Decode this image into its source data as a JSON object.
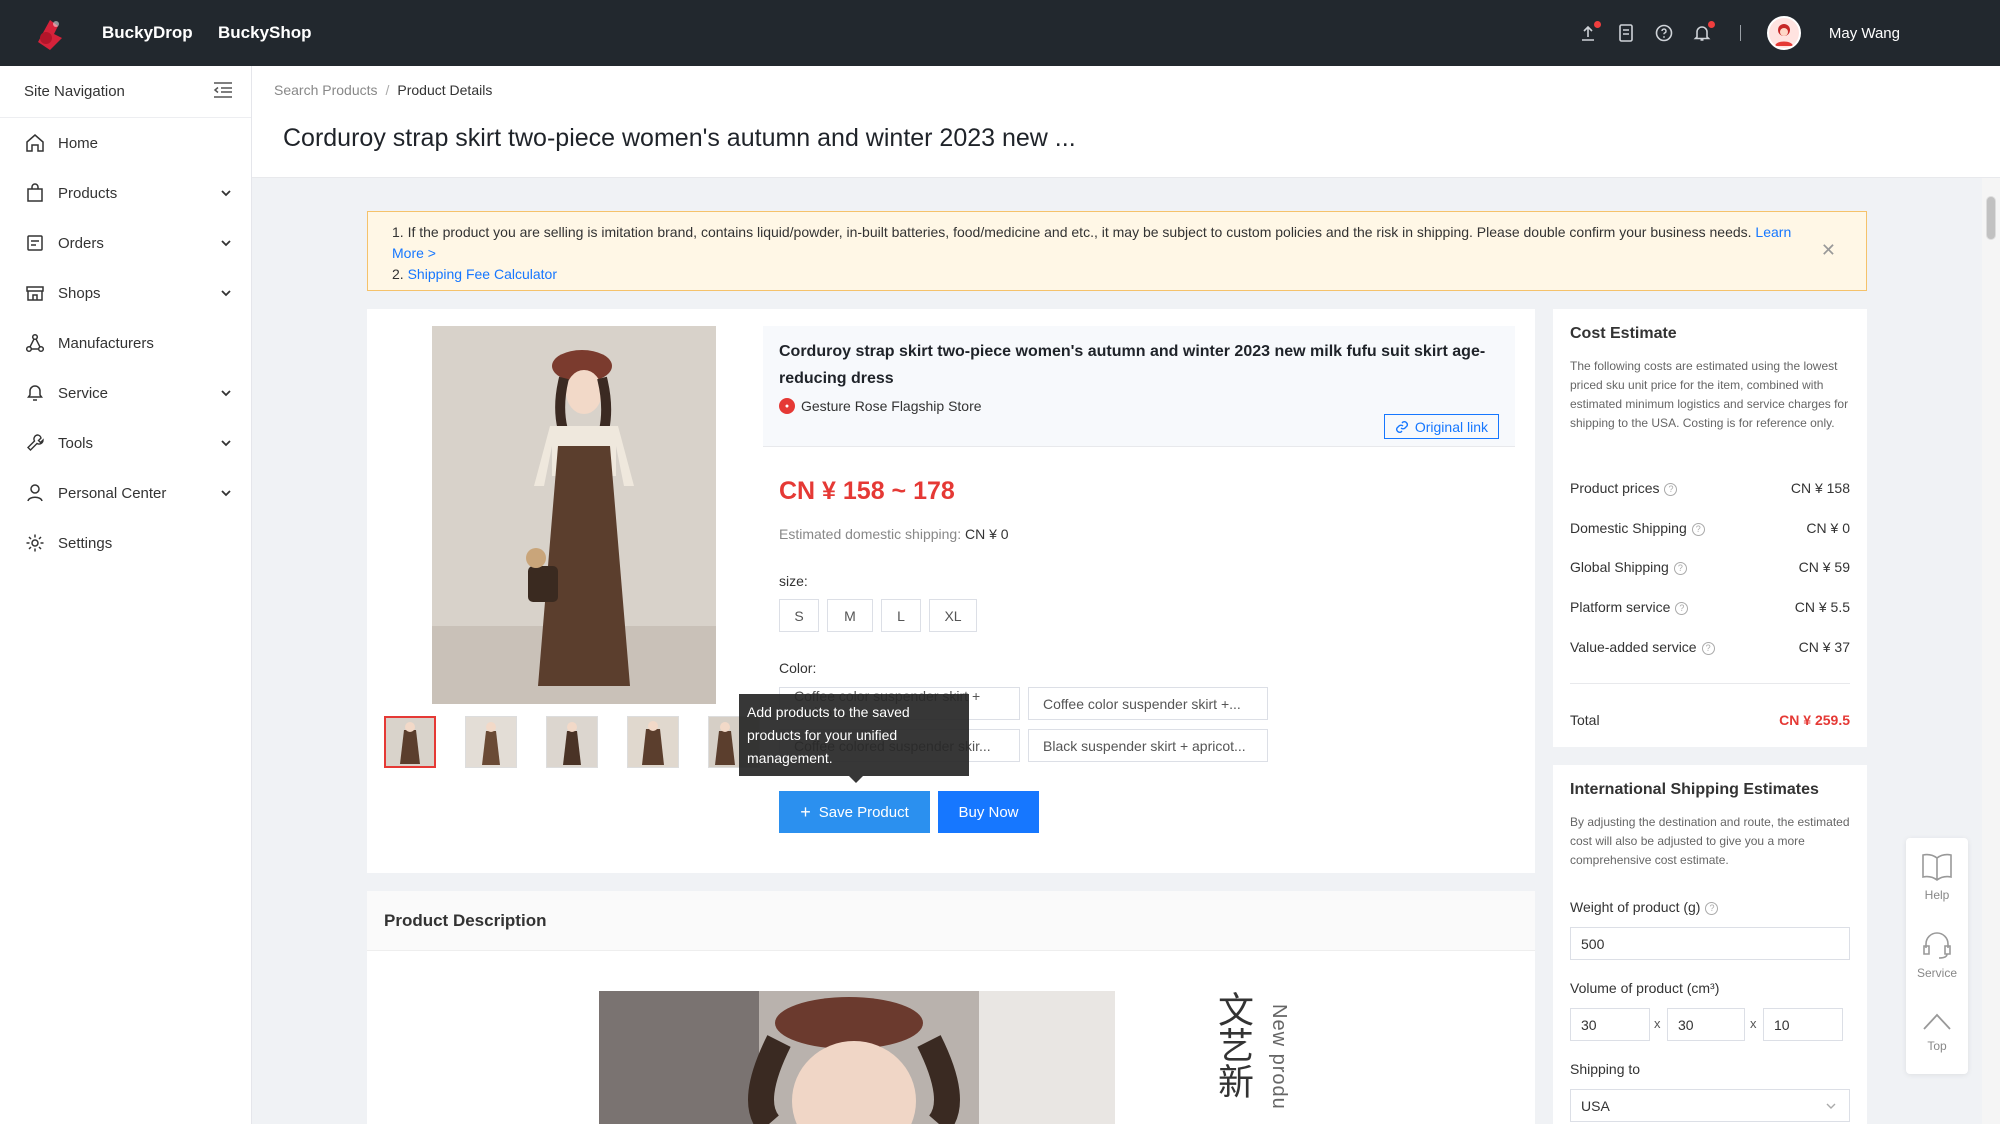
{
  "topbar": {
    "brand1": "BuckyDrop",
    "brand2": "BuckyShop",
    "icons": [
      "upload-icon",
      "document-icon",
      "help-icon",
      "bell-icon"
    ],
    "user_name": "May Wang"
  },
  "sidebar": {
    "title": "Site Navigation",
    "items": [
      {
        "label": "Home",
        "icon": "home-icon",
        "expandable": false
      },
      {
        "label": "Products",
        "icon": "bag-icon",
        "expandable": true
      },
      {
        "label": "Orders",
        "icon": "orders-icon",
        "expandable": true
      },
      {
        "label": "Shops",
        "icon": "shop-icon",
        "expandable": true
      },
      {
        "label": "Manufacturers",
        "icon": "network-icon",
        "expandable": false
      },
      {
        "label": "Service",
        "icon": "service-icon",
        "expandable": true
      },
      {
        "label": "Tools",
        "icon": "wrench-icon",
        "expandable": true
      },
      {
        "label": "Personal Center",
        "icon": "user-icon",
        "expandable": true
      },
      {
        "label": "Settings",
        "icon": "gear-icon",
        "expandable": false
      }
    ]
  },
  "header": {
    "breadcrumb": [
      "Search Products",
      "Product Details"
    ],
    "title": "Corduroy strap skirt two-piece women's autumn and winter 2023 new ..."
  },
  "alert": {
    "line1": "1. If the product you are selling is imitation brand, contains liquid/powder, in-built batteries, food/medicine and etc., it may be subject to custom policies and the risk in shipping. Please double confirm your business needs.",
    "learn_more": "Learn More >",
    "line2_prefix": "2.",
    "calculator": "Shipping Fee Calculator"
  },
  "product": {
    "name": "Corduroy strap skirt two-piece women's autumn and winter 2023 new milk fufu suit skirt age-reducing dress",
    "store": "Gesture Rose Flagship Store",
    "original_link": "Original link",
    "price": "CN ¥ 158 ~ 178",
    "domestic_shipping_label": "Estimated domestic shipping:",
    "domestic_shipping_value": "CN ¥ 0",
    "size_label": "size:",
    "sizes": [
      "S",
      "M",
      "L",
      "XL"
    ],
    "color_label": "Color:",
    "colors": [
      "Coffee color suspender skirt + apricot...",
      "Coffee color suspender skirt +...",
      "Coffee colored suspender skir...",
      "Black suspender skirt + apricot..."
    ],
    "save_button": "Save Product",
    "buy_button": "Buy Now",
    "tooltip": "Add products to the saved products for your unified management."
  },
  "description": {
    "title": "Product Description",
    "cn_text": "文艺新",
    "en_text": "New produ"
  },
  "cost": {
    "title": "Cost Estimate",
    "note": "The following costs are estimated using the lowest priced sku unit price for the item, combined with estimated minimum logistics and service charges for shipping to the USA. Costing is for reference only.",
    "rows": [
      {
        "label": "Product prices",
        "value": "CN ¥ 158"
      },
      {
        "label": "Domestic Shipping",
        "value": "CN ¥ 0"
      },
      {
        "label": "Global Shipping",
        "value": "CN ¥ 59"
      },
      {
        "label": "Platform service",
        "value": "CN ¥ 5.5"
      },
      {
        "label": "Value-added service",
        "value": "CN ¥ 37"
      }
    ],
    "total_label": "Total",
    "total_value": "CN ¥ 259.5"
  },
  "intl": {
    "title": "International Shipping Estimates",
    "note": "By adjusting the destination and route, the estimated cost will also be adjusted to give you a more comprehensive cost estimate.",
    "weight_label": "Weight of product (g)",
    "weight_value": "500",
    "volume_label": "Volume of product (cm³)",
    "volume_values": [
      "30",
      "30",
      "10"
    ],
    "times": "x",
    "ship_to_label": "Shipping to",
    "ship_to_value": "USA"
  },
  "float_tools": {
    "help": "Help",
    "service": "Service",
    "top": "Top"
  },
  "colors": {
    "accent": "#1677ff",
    "price_red": "#e53935",
    "topbar": "#22282e"
  }
}
